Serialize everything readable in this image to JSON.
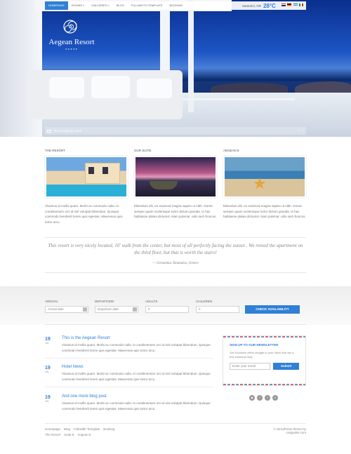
{
  "nav": {
    "items": [
      "Homepage",
      "Rooms »",
      "Galleries »",
      "Blog",
      "Fullwidth Template",
      "Booking"
    ],
    "location": "Santorini, GR",
    "temperature": "28°C"
  },
  "logo": {
    "name": "Aegean Resort",
    "stars": "★★★★★"
  },
  "hero": {
    "caption": "Room balcony view",
    "prev": "‹",
    "next": "›"
  },
  "columns": [
    {
      "title": "The Resort",
      "text": "Vivamus id mollis quam. Morbi ac commodo nulla. In condimentum orci id nisl volutpat bibendum. Quisque commodo hendrerit lorem quis egestas. Maecenas quis tortor arcu."
    },
    {
      "title": "Our Suite",
      "text": "bibendum elit, eu euismod magna sapien ut nibh. Donec semper quam scelerisque tortor dictum gravida. In hac habitasse platea dictumst. Nam pulvinar, odio sed rhoncus."
    },
    {
      "title": "Aegean 8",
      "text": "bibendum elit, eu euismod magna sapien ut nibh. Donec semper quam scelerisque tortor dictum gravida. In hac habitasse platea dictumst. Nam pulvinar, odio sed rhoncus."
    }
  ],
  "quote": {
    "text": "This resort is very nicely located, 10' walk from the center, but most of all perfectly facing the sunset . We rented the apartment on the third floor, but that is worth the stairs!",
    "author": "— Gerasimos Tsiamalos, Greece"
  },
  "booking": {
    "arrival_label": "Arrival",
    "arrival_placeholder": "Arrival date",
    "departure_label": "Departure",
    "departure_placeholder": "Departure date",
    "adults_label": "Adults",
    "adults_value": "0",
    "children_label": "Children",
    "children_value": "2",
    "button": "Check Availability"
  },
  "posts": [
    {
      "day": "19",
      "month": "Jul",
      "title": "This is the Aegean Resort",
      "text": "Vivamus id mollis quam. Morbi ac commodo nulla. In condimentum orci id nisl volutpat bibendum. Quisque commodo hendrerit lorem quis egestas. Maecenas quis tortor arcu."
    },
    {
      "day": "19",
      "month": "Jul",
      "title": "Hotel News",
      "text": "Vivamus id mollis quam. Morbi ac commodo nulla. In condimentum orci id nisl volutpat bibendum. Quisque commodo hendrerit lorem quis egestas. Maecenas quis tortor arcu."
    },
    {
      "day": "19",
      "month": "Jul",
      "title": "And one more blog post",
      "text": "Vivamus id mollis quam. Morbi ac commodo nulla. In condimentum orci id nisl volutpat bibendum. Quisque commodo hendrerit lorem quis egestas. Maecenas quis tortor arcu."
    }
  ],
  "newsletter": {
    "title": "Sign up to our newsletter",
    "text": "Get exclusive offers straight to your inbox and win a free weekend stay.",
    "placeholder": "Enter your email",
    "button": "Submit"
  },
  "social": [
    "rss-icon",
    "twitter-icon",
    "facebook-icon",
    "skype-icon"
  ],
  "footer": {
    "row1": [
      "Homepage",
      "Blog",
      "Fullwidth Template",
      "Booking"
    ],
    "row2": [
      "The Resort",
      "Suite 8",
      "Aegean 8"
    ],
    "credit": "© WordPress theme by cssignder.com"
  },
  "colors": {
    "accent": "#2f80d6"
  }
}
